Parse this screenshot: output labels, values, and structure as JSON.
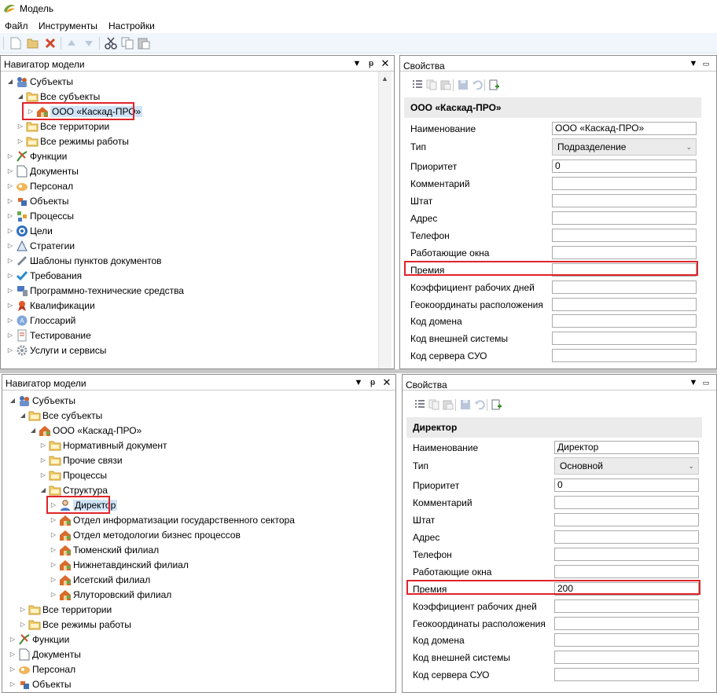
{
  "app": {
    "title": "Модель"
  },
  "menu": {
    "items": [
      "Файл",
      "Инструменты",
      "Настройки"
    ]
  },
  "top": {
    "navigator": {
      "title": "Навигатор модели",
      "items": [
        "Субъекты",
        "Все субъекты",
        "ООО «Каскад-ПРО»",
        "Все территории",
        "Все режимы работы",
        "Функции",
        "Документы",
        "Персонал",
        "Объекты",
        "Процессы",
        "Цели",
        "Стратегии",
        "Шаблоны пунктов документов",
        "Требования",
        "Программно-технические средства",
        "Квалификации",
        "Глоссарий",
        "Тестирование",
        "Услуги и сервисы"
      ]
    },
    "properties": {
      "title": "Свойства",
      "object": "ООО «Каскад-ПРО»",
      "labels": [
        "Наименование",
        "Тип",
        "Приоритет",
        "Комментарий",
        "Штат",
        "Адрес",
        "Телефон",
        "Работающие окна",
        "Премия",
        "Коэффициент рабочих дней",
        "Геокоординаты расположения",
        "Код домена",
        "Код внешней системы",
        "Код сервера СУО"
      ],
      "values": [
        "ООО «Каскад-ПРО»",
        "Подразделение",
        "0",
        "",
        "",
        "",
        "",
        "",
        "",
        "",
        "",
        "",
        "",
        ""
      ]
    }
  },
  "bottom": {
    "navigator": {
      "title": "Навигатор модели",
      "items": [
        "Субъекты",
        "Все субъекты",
        "ООО «Каскад-ПРО»",
        "Нормативный документ",
        "Прочие связи",
        "Процессы",
        "Структура",
        "Директор",
        "Отдел информатизации государственного сектора",
        "Отдел методологии бизнес процессов",
        "Тюменский филиал",
        "Нижнетавдинский филиал",
        "Исетский филиал",
        "Ялуторовский филиал",
        "Все территории",
        "Все режимы работы",
        "Функции",
        "Документы",
        "Персонал",
        "Объекты"
      ]
    },
    "properties": {
      "title": "Свойства",
      "object": "Директор",
      "labels": [
        "Наименование",
        "Тип",
        "Приоритет",
        "Комментарий",
        "Штат",
        "Адрес",
        "Телефон",
        "Работающие окна",
        "Премия",
        "Коэффициент рабочих дней",
        "Геокоординаты расположения",
        "Код домена",
        "Код внешней системы",
        "Код сервера СУО"
      ],
      "values": [
        "Директор",
        "Основной",
        "0",
        "",
        "",
        "",
        "",
        "",
        "200",
        "",
        "",
        "",
        "",
        ""
      ]
    }
  },
  "colors": {
    "highlight": "#e0242b",
    "selection": "#cfe4f7",
    "toolbar": "#f0f6fb"
  },
  "icons": {
    "toolbar": [
      "new-icon",
      "open-icon",
      "delete-icon",
      "move-up-icon",
      "move-down-icon",
      "cut-icon",
      "copy-icon",
      "paste-icon"
    ],
    "properties_toolbar": [
      "properties-list-icon",
      "copy-icon",
      "paste-icon",
      "save-icon",
      "undo-icon",
      "export-icon"
    ]
  }
}
